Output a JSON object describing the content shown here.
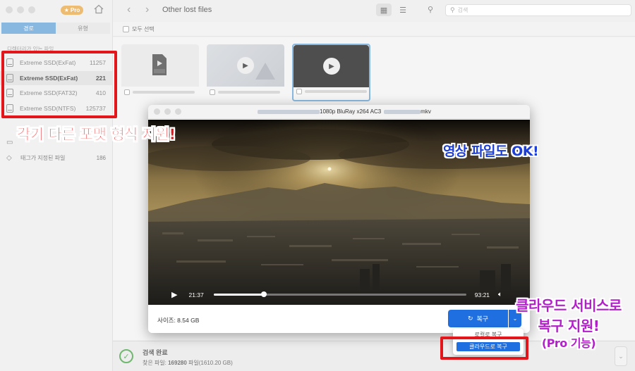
{
  "sidebar": {
    "pro_badge": "Pro",
    "tabs": [
      {
        "label": "경로",
        "active": true
      },
      {
        "label": "유형",
        "active": false
      }
    ],
    "section_title": "디렉터리가 있는 파일",
    "drives": [
      {
        "name": "Extreme SSD(ExFat)",
        "count": "11257",
        "selected": false
      },
      {
        "name": "Extreme SSD(ExFat)",
        "count": "221",
        "selected": true
      },
      {
        "name": "Extreme SSD(FAT32)",
        "count": "410",
        "selected": false
      },
      {
        "name": "Extreme SSD(NTFS)",
        "count": "125737",
        "selected": false
      }
    ],
    "tagged_item": {
      "label": "태그가 지정된 파일",
      "count": "186"
    }
  },
  "toolbar": {
    "title": "Other lost files",
    "search_placeholder": "검색",
    "select_all": "모두 선택"
  },
  "video_window": {
    "title_middle": "1080p BluRay x264 AC3",
    "title_end": "mkv",
    "current_time": "21:37",
    "total_time": "93:21",
    "progress": 0.2,
    "size_label": "사이즈: 8.54 GB",
    "recover_button": "복구",
    "menu_items": [
      "로컬로 복구",
      "클라우드로 복구"
    ]
  },
  "status": {
    "title": "검색 완료",
    "found_prefix": "찾은 파일: ",
    "found_count": "169280",
    "found_suffix": " 파일(1610.20 GB)"
  },
  "annotations": {
    "formats": "각기 다른 포맷 형식 지원!",
    "video_ok": "영상 파일도 OK!",
    "cloud_line1": "클라우드 서비스로",
    "cloud_line2": "복구 지원!",
    "cloud_line3": "(Pro 기능)"
  },
  "colors": {
    "accent_blue": "#1f6fe0",
    "annotation_red": "#e3161b",
    "annotation_blue": "#1d3fd8",
    "annotation_purple": "#b120c9",
    "success_green": "#3a9c3a"
  }
}
